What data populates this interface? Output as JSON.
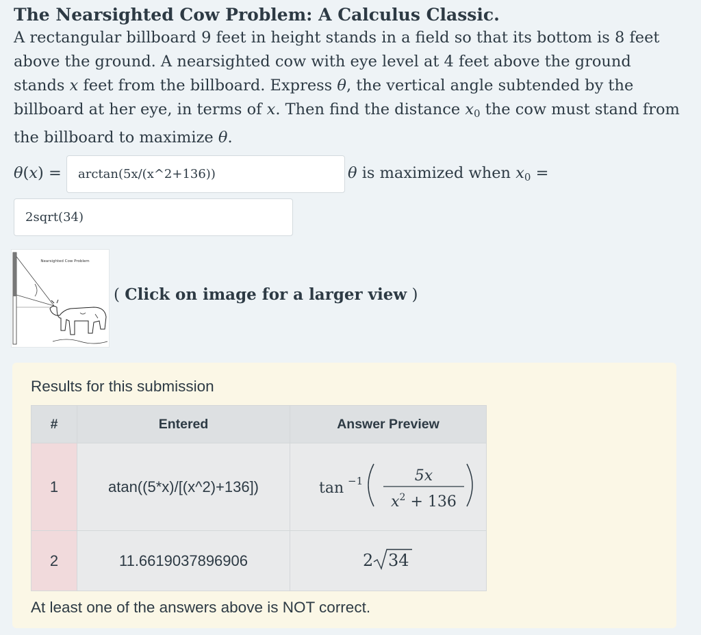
{
  "problem": {
    "title": "The Nearsighted Cow Problem: A Calculus Classic.",
    "statement_part1": "A rectangular billboard 9 feet in height stands in a field so that its bottom is 8 feet above the ground. A nearsighted cow with eye level at 4 feet above the ground stands ",
    "var_x": "x",
    "statement_part2": " feet from the billboard. Express ",
    "var_theta": "θ",
    "statement_part3": ", the vertical angle subtended by the billboard at her eye, in terms of ",
    "statement_part4": ". Then find the distance ",
    "var_x0": "x",
    "sub_0": "0",
    "statement_part5": " the cow must stand from the billboard to maximize ",
    "statement_end": "."
  },
  "answer1": {
    "label_theta": "θ",
    "label_paren_open": "(",
    "label_x": "x",
    "label_paren_close": ") =",
    "value": "arctan(5x/(x^2+136))"
  },
  "answer2": {
    "label_theta": "θ",
    "label_text": " is maximized when ",
    "label_x": "x",
    "label_sub": "0",
    "label_eq": " =",
    "value": "2sqrt(34)"
  },
  "image": {
    "caption": "Nearsighted Cow Problem",
    "click_paren_open": "( ",
    "click_text": "Click on image for a larger view",
    "click_paren_close": " )"
  },
  "results": {
    "heading": "Results for this submission",
    "columns": [
      "#",
      "Entered",
      "Answer Preview"
    ],
    "rows": [
      {
        "num": "1",
        "entered": "atan((5*x)/[(x^2)+136])",
        "preview": {
          "fn": "tan",
          "exp": "−1",
          "numerator": "5x",
          "den_var": "x",
          "den_exp": "2",
          "den_rest": " + 136"
        }
      },
      {
        "num": "2",
        "entered": "11.6619037896906",
        "preview": {
          "coef": "2",
          "radicand": "34"
        }
      }
    ],
    "status": "At least one of the answers above is NOT correct."
  }
}
